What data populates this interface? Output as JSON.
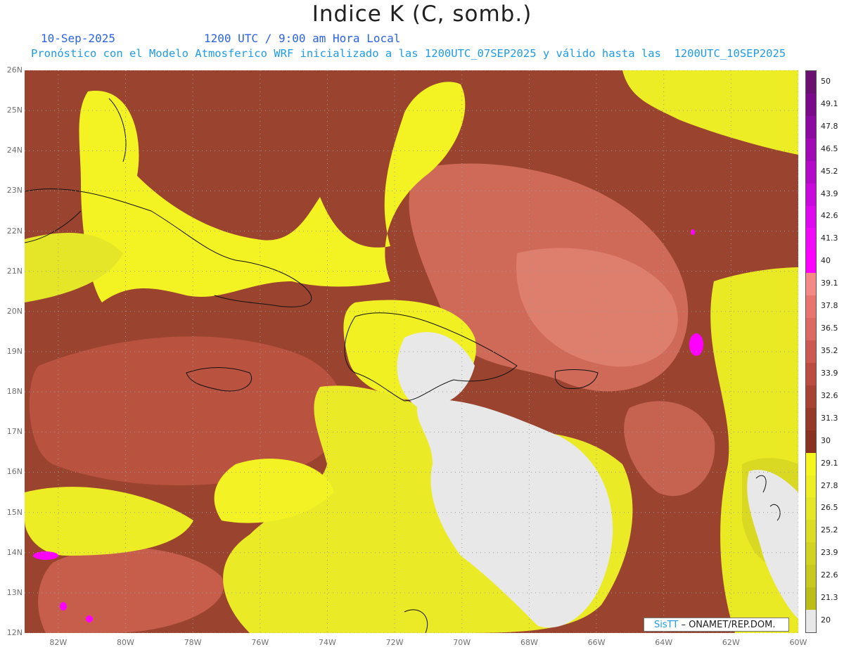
{
  "title": "Indice K (C, somb.)",
  "date_label": "10-Sep-2025",
  "utc_label": "1200 UTC / 9:00 am Hora Local",
  "forecast_label": "Pronóstico con el Modelo Atmosferico WRF inicializado a las 1200UTC_07SEP2025 y válido hasta las  1200UTC_10SEP2025",
  "credit": {
    "brand": "SisTT",
    "text": "– ONAMET/REP.DOM."
  },
  "map": {
    "lat_range": [
      12,
      26
    ],
    "lon_range": [
      -83,
      -60
    ],
    "lat_labels": [
      "26N",
      "25N",
      "24N",
      "23N",
      "22N",
      "21N",
      "20N",
      "19N",
      "18N",
      "17N",
      "16N",
      "15N",
      "14N",
      "13N",
      "12N"
    ],
    "lon_labels": [
      "82W",
      "80W",
      "78W",
      "76W",
      "74W",
      "72W",
      "70W",
      "68W",
      "66W",
      "64W",
      "62W",
      "60W"
    ],
    "gridlines": "dotted"
  },
  "colorbar": {
    "levels": [
      "50",
      "49.1",
      "47.8",
      "46.5",
      "45.2",
      "43.9",
      "42.6",
      "41.3",
      "40",
      "39.1",
      "37.8",
      "36.5",
      "35.2",
      "33.9",
      "32.6",
      "31.3",
      "30",
      "29.1",
      "27.8",
      "26.5",
      "25.2",
      "23.9",
      "22.6",
      "21.3",
      "20"
    ],
    "colors": [
      "#6a1070",
      "#7a0a8a",
      "#8c0aa0",
      "#a00ab5",
      "#b40ac8",
      "#c80adc",
      "#dc0aec",
      "#f00af5",
      "#ff00ff",
      "#f48a86",
      "#e9766e",
      "#db6a60",
      "#cd5a50",
      "#bb4c40",
      "#a84232",
      "#963a28",
      "#8a3220",
      "#f5f520",
      "#eeee24",
      "#e6e628",
      "#dcdc26",
      "#d2d222",
      "#c8c81e",
      "#bdbd1a",
      "#e8e8e8"
    ]
  }
}
